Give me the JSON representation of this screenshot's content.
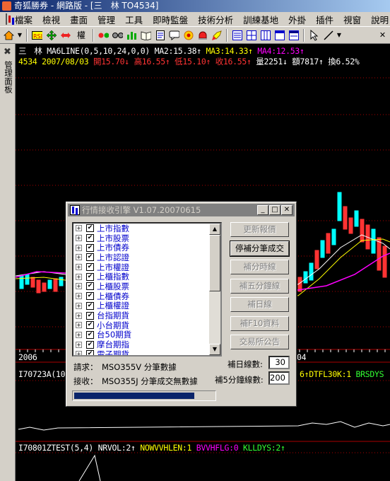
{
  "window": {
    "title": "奇狐勝券 - 網路版 - [三　林 TO4534]"
  },
  "menu": [
    "檔案",
    "檢視",
    "畫面",
    "管理",
    "工具",
    "即時監盤",
    "技術分析",
    "訓練基地",
    "外掛",
    "插件",
    "視窗",
    "說明"
  ],
  "toolbar": {
    "icons": [
      "home-icon",
      "rsi-icon",
      "move-icon",
      "arrows-icon",
      "weight-icon",
      "balls-icon",
      "glasses-icon",
      "bar-chart-icon",
      "book-icon",
      "paper-icon",
      "chat-icon",
      "gear-ball-icon",
      "alarm-icon",
      "rocket-icon",
      "list-icon",
      "grid-icon",
      "table-icon",
      "panel-icon",
      "window-icon",
      "cursor-icon",
      "line-draw-icon",
      "chevron-down-icon",
      "close-icon"
    ],
    "weight_label": "權"
  },
  "sidebar": {
    "label": "管理面板"
  },
  "chart": {
    "info_line1": {
      "stock": "三　林",
      "ma6": "MA6LINE(0,5,10,24,0,0)",
      "ma2": "MA2:15.38↑",
      "ma3": "MA3:14.33↑",
      "ma4": "MA4:12.53↑"
    },
    "info_line2": {
      "code_date": "4534 2007/08/03",
      "open": "開15.70↓",
      "high": "高16.55↑",
      "low": "低15.10↑",
      "close": "收16.55↑",
      "volume": "量2251↓",
      "amount": "額7817↑",
      "turnover": "換6.52%"
    },
    "dates": {
      "left": "2006",
      "right": "04"
    },
    "panel2": {
      "name": "I70723A(10",
      "right1": "6↑DTFL30K:1",
      "right2": "BRSDYS"
    },
    "panel3": {
      "name": "I70801ZTEST(5,4)",
      "nrvol": "NRVOL:2↑",
      "nowvv": "NOWVVHLEN:1",
      "bvvh": "BVVHFLG:0",
      "klld": "KLLDYS:2↑"
    },
    "colors": {
      "candle_up": "#ff3333",
      "candle_down": "#00ffff",
      "ma_white": "#ffffff",
      "ma_yellow": "#ffff00",
      "ma_magenta": "#ff00ff",
      "grid": "#aa0000"
    }
  },
  "dialog": {
    "title": "行情接收引擎 V1.07.20070615",
    "list_items": [
      "上市指數",
      "上市股票",
      "上市債券",
      "上市認證",
      "上市權證",
      "上櫃指數",
      "上櫃股票",
      "上櫃債券",
      "上櫃權證",
      "台指期貨",
      "小台期貨",
      "台50期貨",
      "摩台期指",
      "電子期貨"
    ],
    "buttons": [
      "更新報價",
      "停補分筆成交",
      "補分時線",
      "補五分鐘線",
      "補日線",
      "補F10資料",
      "交易所公告"
    ],
    "active_button_index": 1,
    "request_label": "請求：",
    "request_text": "MSO355V 分筆數據",
    "receive_label": "接收：",
    "receive_text": "MSO355J 分筆成交無數據",
    "daily_lines_label": "補日線數:",
    "daily_lines_value": "30",
    "five_min_label": "補5分鐘線數:",
    "five_min_value": "200",
    "progress_fraction": 0.85
  }
}
